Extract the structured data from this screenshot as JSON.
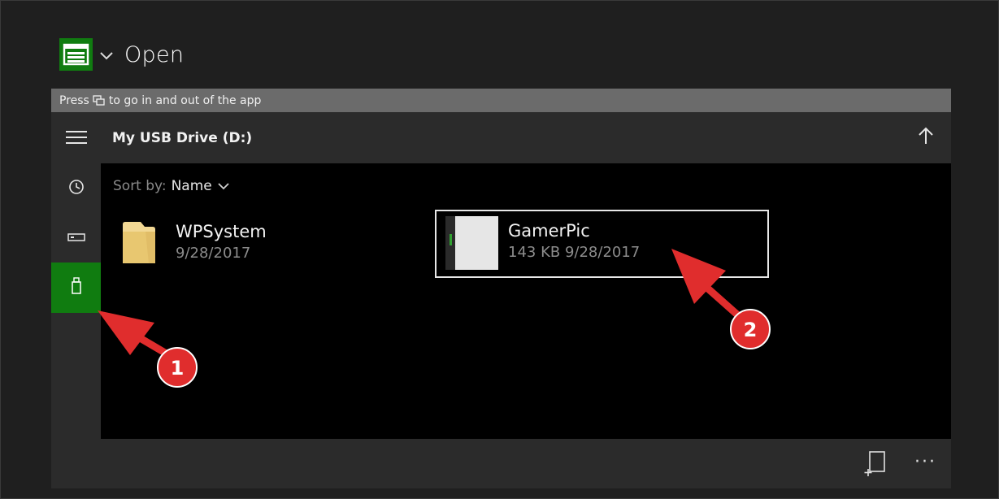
{
  "header": {
    "title": "Open"
  },
  "hint_bar": {
    "prefix": "Press",
    "suffix": "to go in and out of the app"
  },
  "location": {
    "title": "My USB Drive (D:)"
  },
  "sort": {
    "label": "Sort by:",
    "value": "Name"
  },
  "files": [
    {
      "name": "WPSystem",
      "meta": "9/28/2017",
      "type": "folder"
    },
    {
      "name": "GamerPic",
      "meta": "143 KB 9/28/2017",
      "type": "image"
    }
  ],
  "bottombar": {
    "more_label": "···"
  },
  "annotations": [
    {
      "number": "1"
    },
    {
      "number": "2"
    }
  ],
  "colors": {
    "accent": "#107c10",
    "background": "#1f1f1f",
    "panel": "#2b2b2b",
    "content": "#000000",
    "annotation": "#e02d2d"
  },
  "icons": {
    "app": "file-explorer-icon",
    "menu": "hamburger-icon",
    "recent": "clock-icon",
    "drive": "drive-icon",
    "usb": "usb-icon",
    "up": "arrow-up-icon",
    "new": "new-folder-icon",
    "more": "more-icon"
  }
}
